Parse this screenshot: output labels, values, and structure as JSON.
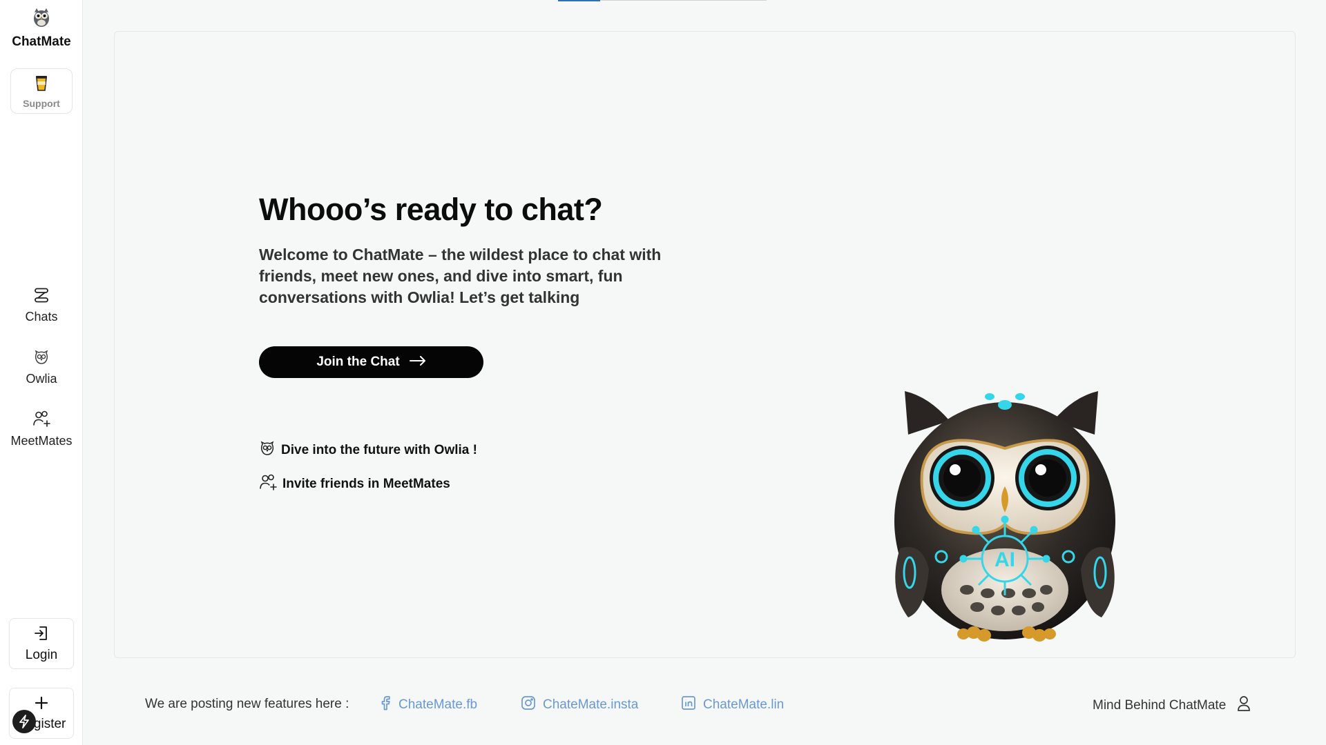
{
  "sidebar": {
    "brand": "ChatMate",
    "support": "Support",
    "items": [
      {
        "label": "Chats",
        "icon": "chats-icon"
      },
      {
        "label": "Owlia",
        "icon": "owl-icon"
      },
      {
        "label": "MeetMates",
        "icon": "add-user-icon"
      }
    ],
    "login": "Login",
    "register": "Register"
  },
  "hero": {
    "title": "Whooo’s ready to chat?",
    "subtitle": "Welcome to ChatMate – the wildest place to chat with friends, meet new ones, and dive into smart, fun conversations with Owlia! Let’s get talking",
    "cta": "Join the Chat",
    "features": [
      {
        "label": "Dive into the future with Owlia !",
        "icon": "owl-icon"
      },
      {
        "label": "Invite friends in MeetMates",
        "icon": "add-user-icon"
      }
    ],
    "illustration_text": "AI"
  },
  "footer": {
    "note": "We are posting new features here :",
    "links": [
      {
        "label": "ChateMate.fb",
        "icon": "facebook-icon"
      },
      {
        "label": "ChateMate.insta",
        "icon": "instagram-icon"
      },
      {
        "label": "ChateMate.lin",
        "icon": "linkedin-icon"
      }
    ],
    "mind": "Mind Behind ChatMate"
  },
  "colors": {
    "accent": "#2f6fb3",
    "link": "#6a98d4",
    "cta_bg": "#050505",
    "owl_glow": "#35d6ea"
  }
}
